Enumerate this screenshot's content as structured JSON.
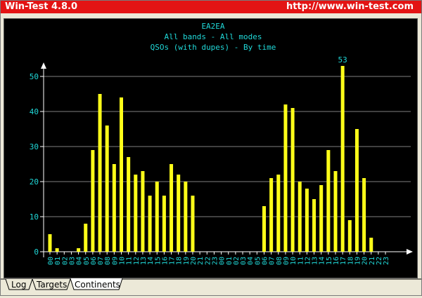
{
  "window": {
    "title": "Win-Test 4.8.0",
    "url": "http://www.win-test.com"
  },
  "tabs": [
    {
      "label": "Log"
    },
    {
      "label": "Targets"
    },
    {
      "label": "Continents",
      "active": true
    }
  ],
  "chart_data": {
    "type": "bar",
    "title": "EA2EA",
    "subtitle": "All bands - All modes",
    "subtitle2": "QSOs (with dupes) - By time",
    "xlabel": "",
    "ylabel": "",
    "ylim": [
      0,
      55
    ],
    "yticks": [
      0,
      10,
      20,
      30,
      40,
      50
    ],
    "grid": true,
    "peak_label": "53",
    "colors": {
      "background": "#000000",
      "bar": "#ffff19",
      "text": "#20d8d8",
      "axis": "#ffffff",
      "grid": "#808080"
    },
    "categories": [
      "00",
      "01",
      "02",
      "03",
      "04",
      "05",
      "06",
      "07",
      "08",
      "09",
      "10",
      "11",
      "12",
      "13",
      "14",
      "15",
      "16",
      "17",
      "18",
      "19",
      "20",
      "21",
      "22",
      "23",
      "00",
      "01",
      "02",
      "03",
      "04",
      "05",
      "06",
      "07",
      "08",
      "09",
      "10",
      "11",
      "12",
      "13",
      "14",
      "15",
      "16",
      "17",
      "18",
      "19",
      "20",
      "21",
      "22",
      "23"
    ],
    "values": [
      5,
      1,
      0,
      0,
      1,
      8,
      29,
      45,
      36,
      25,
      44,
      27,
      22,
      23,
      16,
      20,
      16,
      25,
      22,
      20,
      16,
      0,
      0,
      0,
      0,
      0,
      0,
      0,
      0,
      0,
      13,
      21,
      22,
      42,
      41,
      20,
      18,
      15,
      19,
      29,
      23,
      53,
      9,
      35,
      21,
      4,
      0,
      0
    ]
  }
}
